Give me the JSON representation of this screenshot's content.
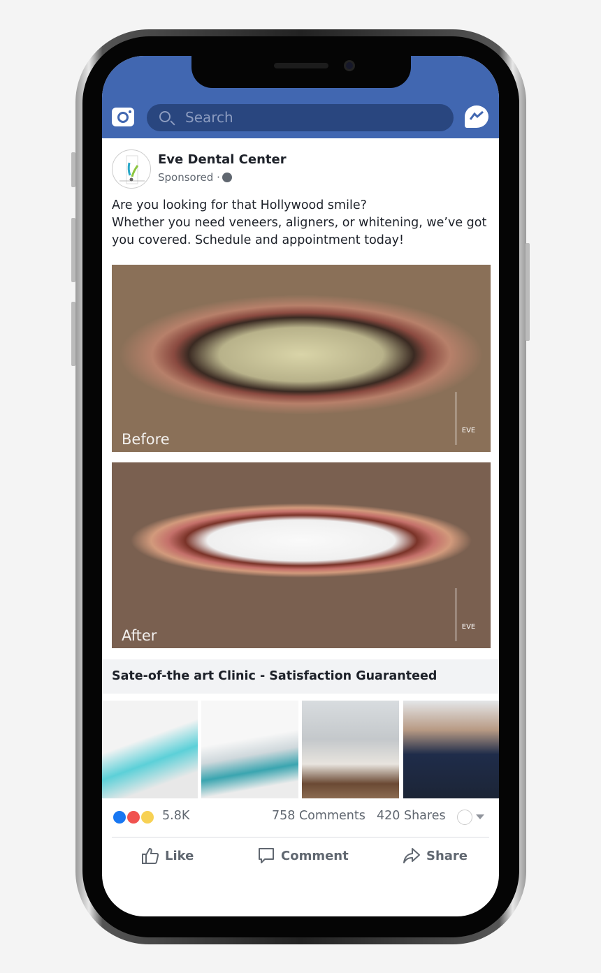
{
  "search": {
    "placeholder": "Search"
  },
  "post": {
    "page_name": "Eve Dental Center",
    "sponsored": "Sponsored",
    "separator": "·",
    "text_line1": "Are you looking for that Hollywood smile?",
    "text_line2": "Whether you need veneers, aligners, or whitening, we’ve got you covered. Schedule and appointment today!",
    "photos": [
      {
        "label": "Before"
      },
      {
        "label": "After"
      }
    ],
    "watermark": "EVE",
    "caption": "Sate-of-the art Clinic - Satisfaction Guaranteed",
    "reactions_count": "5.8K",
    "comments": "758 Comments",
    "shares": "420 Shares",
    "actions": {
      "like": "Like",
      "comment": "Comment",
      "share": "Share"
    }
  },
  "colors": {
    "brand": "#4167b1",
    "like": "#1877f2",
    "love": "#f0524f",
    "wow": "#f7d154"
  }
}
